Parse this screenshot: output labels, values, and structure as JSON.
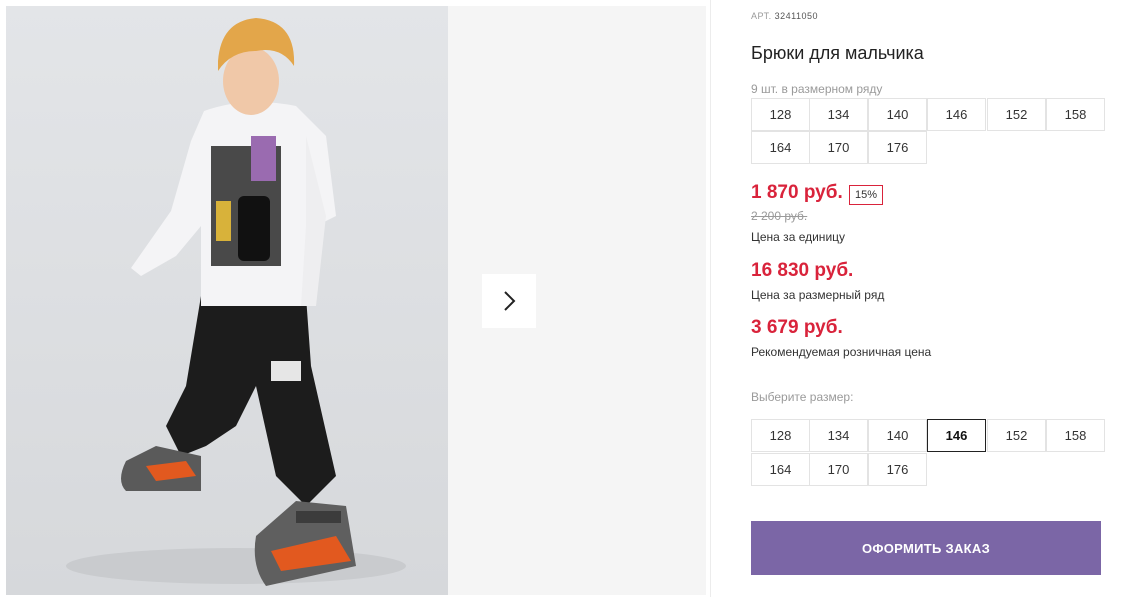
{
  "product": {
    "article_label": "АРТ.",
    "article_number": "32411050",
    "title": "Брюки для мальчика",
    "row_note": "9 шт. в размерном ряду"
  },
  "size_row": [
    "128",
    "134",
    "140",
    "146",
    "152",
    "158",
    "164",
    "170",
    "176"
  ],
  "pricing": {
    "unit_price": "1 870 руб.",
    "discount": "15%",
    "old_price": "2 200 руб.",
    "unit_label": "Цена за единицу",
    "row_price": "16 830 руб.",
    "row_label": "Цена за размерный ряд",
    "retail_price": "3 679 руб.",
    "retail_label": "Рекомендуемая розничная цена"
  },
  "size_select": {
    "label": "Выберите размер:",
    "options": [
      "128",
      "134",
      "140",
      "146",
      "152",
      "158",
      "164",
      "170",
      "176"
    ],
    "selected": "146"
  },
  "order_button": "ОФОРМИТЬ ЗАКАЗ",
  "icons": {
    "gallery_next": "chevron-right-icon"
  },
  "colors": {
    "accent": "#7b66a6",
    "price_red": "#d9233b"
  }
}
